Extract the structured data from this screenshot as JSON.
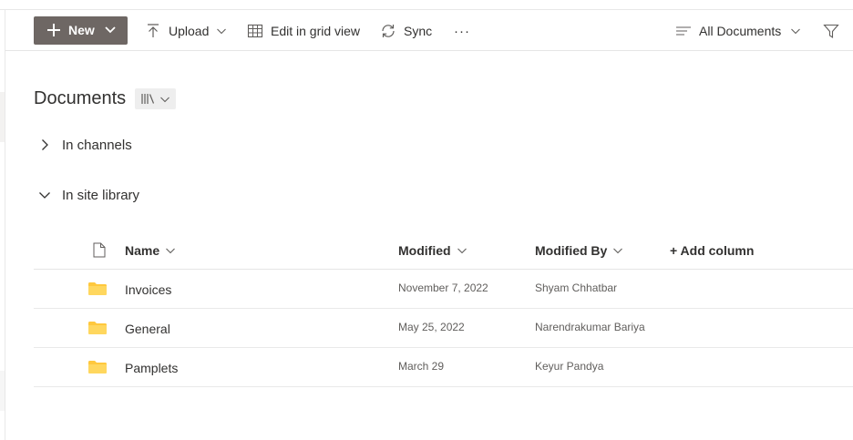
{
  "command_bar": {
    "new_label": "New",
    "upload_label": "Upload",
    "grid_label": "Edit in grid view",
    "sync_label": "Sync",
    "more_label": "···",
    "view_label": "All Documents"
  },
  "library": {
    "title": "Documents"
  },
  "groups": {
    "channels_label": "In channels",
    "site_label": "In site library"
  },
  "table": {
    "columns": {
      "name": "Name",
      "modified": "Modified",
      "modified_by": "Modified By",
      "add_column": "+ Add column"
    },
    "rows": [
      {
        "name": "Invoices",
        "modified": "November 7, 2022",
        "modified_by": "Shyam Chhatbar"
      },
      {
        "name": "General",
        "modified": "May 25, 2022",
        "modified_by": "Narendrakumar Bariya"
      },
      {
        "name": "Pamplets",
        "modified": "March 29",
        "modified_by": "Keyur Pandya"
      }
    ]
  },
  "colors": {
    "new_button_bg": "#6e6764",
    "folder_yellow": "#ffc83d",
    "text_primary": "#323130",
    "text_secondary": "#605e5c"
  },
  "icons": [
    "plus-icon",
    "upload-icon",
    "grid-icon",
    "sync-icon",
    "more-icon",
    "view-lines-icon",
    "filter-icon",
    "library-icon",
    "chevron-right-icon",
    "chevron-down-icon",
    "file-icon",
    "folder-icon"
  ]
}
